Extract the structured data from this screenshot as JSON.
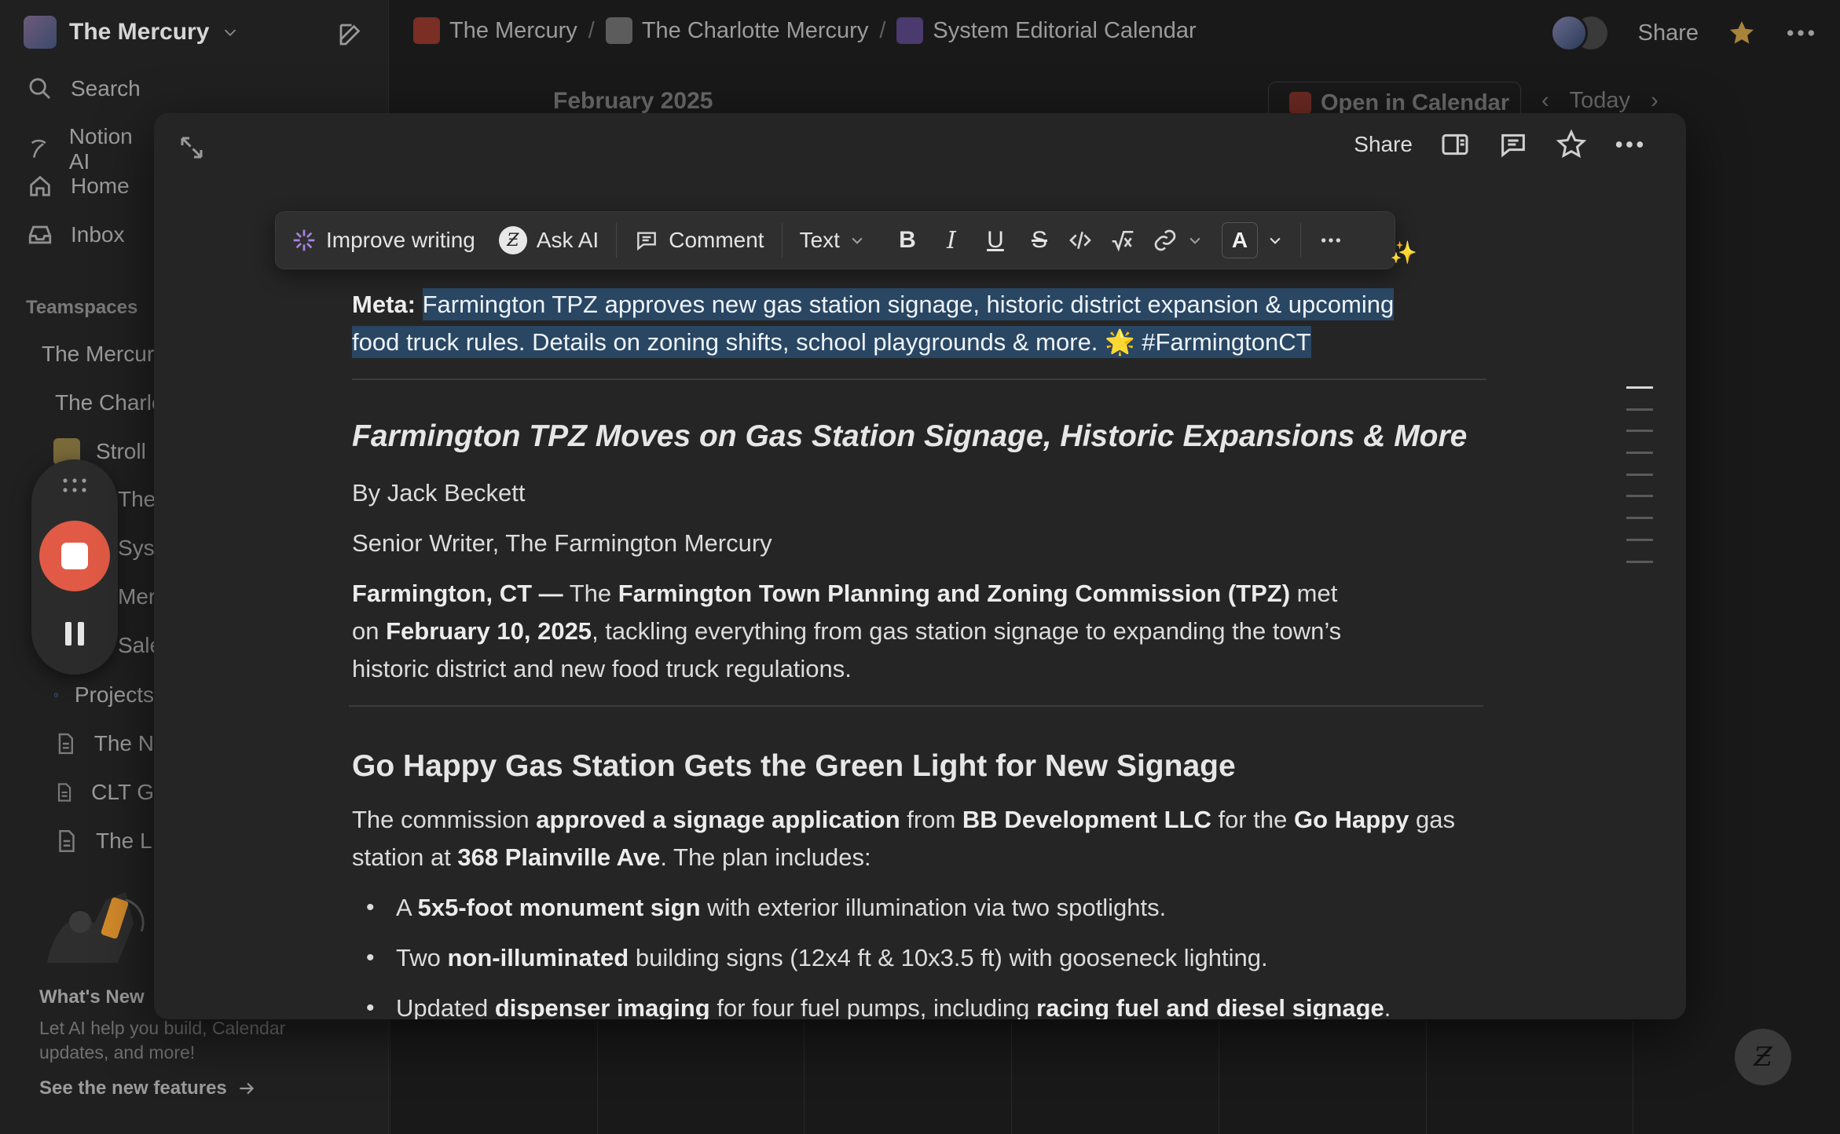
{
  "sidebar": {
    "workspace_name": "The Mercury",
    "nav": [
      {
        "label": "Search",
        "icon": "search-icon"
      },
      {
        "label": "Notion AI",
        "icon": "notion-ai-icon"
      },
      {
        "label": "Home",
        "icon": "home-icon"
      },
      {
        "label": "Inbox",
        "icon": "inbox-icon"
      }
    ],
    "teamspaces_label": "Teamspaces",
    "tree": [
      {
        "label": "The Mercury",
        "color": "#8a3a2a"
      },
      {
        "label": "The Charlotte Mercury",
        "color": "#6a6a6a"
      },
      {
        "label": "Stroll",
        "color": "#7a6a3a"
      },
      {
        "label": "The F",
        "color": "#5a5a5a"
      },
      {
        "label": "System",
        "color": "#5a4a7a"
      },
      {
        "label": "Mercury",
        "color": "#5a5a5a"
      },
      {
        "label": "Sales",
        "color": "#5a5a5a"
      },
      {
        "label": "Projects",
        "color": "#3a6ab0"
      },
      {
        "label": "The N",
        "color": "#555555"
      },
      {
        "label": "CLT G",
        "color": "#555555"
      },
      {
        "label": "The L",
        "color": "#555555"
      }
    ],
    "whats_new_title": "What's New",
    "whats_new_desc": "Let AI help you build, Calendar updates, and more!",
    "see_new_label": "See the new features"
  },
  "topbar": {
    "breadcrumbs": [
      "The Mercury",
      "The Charlotte Mercury",
      "System Editorial Calendar"
    ],
    "share_label": "Share"
  },
  "calendar": {
    "month": "February 2025",
    "open_label": "Open in Calendar",
    "today_label": "Today"
  },
  "modal": {
    "share_label": "Share",
    "toolbar": {
      "improve": "Improve writing",
      "ask_ai": "Ask AI",
      "comment": "Comment",
      "text": "Text",
      "color_letter": "A"
    },
    "meta_label": "Meta:",
    "meta_line1": "Farmington TPZ approves new gas station signage, historic district expansion & upcoming",
    "meta_line2": "food truck rules. Details on zoning shifts, school playgrounds & more. 🌟 #FarmingtonCT",
    "title": "Farmington TPZ Moves on Gas Station Signage, Historic Expansions & More",
    "byline": "By Jack Beckett",
    "role": "Senior Writer, The Farmington Mercury",
    "intro": {
      "a": "Farmington, CT —",
      "b": " The ",
      "c": "Farmington Town Planning and Zoning Commission (TPZ)",
      "d": " met",
      "e": "on ",
      "f": "February 10, 2025",
      "g": ", tackling everything from gas station signage to expanding the town’s",
      "h": "historic district and new food truck regulations."
    },
    "section_heading": "Go Happy Gas Station Gets the Green Light for New Signage",
    "section_para": {
      "a": "The commission ",
      "b": "approved a signage application",
      "c": " from ",
      "d": "BB Development LLC",
      "e": " for the ",
      "f": "Go Happy",
      "g": " gas",
      "h": "station at ",
      "i": "368 Plainville Ave",
      "j": ". The plan includes:"
    },
    "bullets": [
      {
        "a": "A ",
        "b": "5x5-foot monument sign",
        "c": " with exterior illumination via two spotlights."
      },
      {
        "a": "Two ",
        "b": "non-illuminated",
        "c": " building signs (12x4 ft & 10x3.5 ft) with gooseneck lighting."
      },
      {
        "a": "Updated ",
        "b": "dispenser imaging",
        "c": " for four fuel pumps, including ",
        "d": "racing fuel and diesel signage",
        "e": "."
      }
    ]
  },
  "colors": {
    "accent_highlight": "#294663",
    "record": "#e05a45",
    "favorite": "#a8833a"
  }
}
